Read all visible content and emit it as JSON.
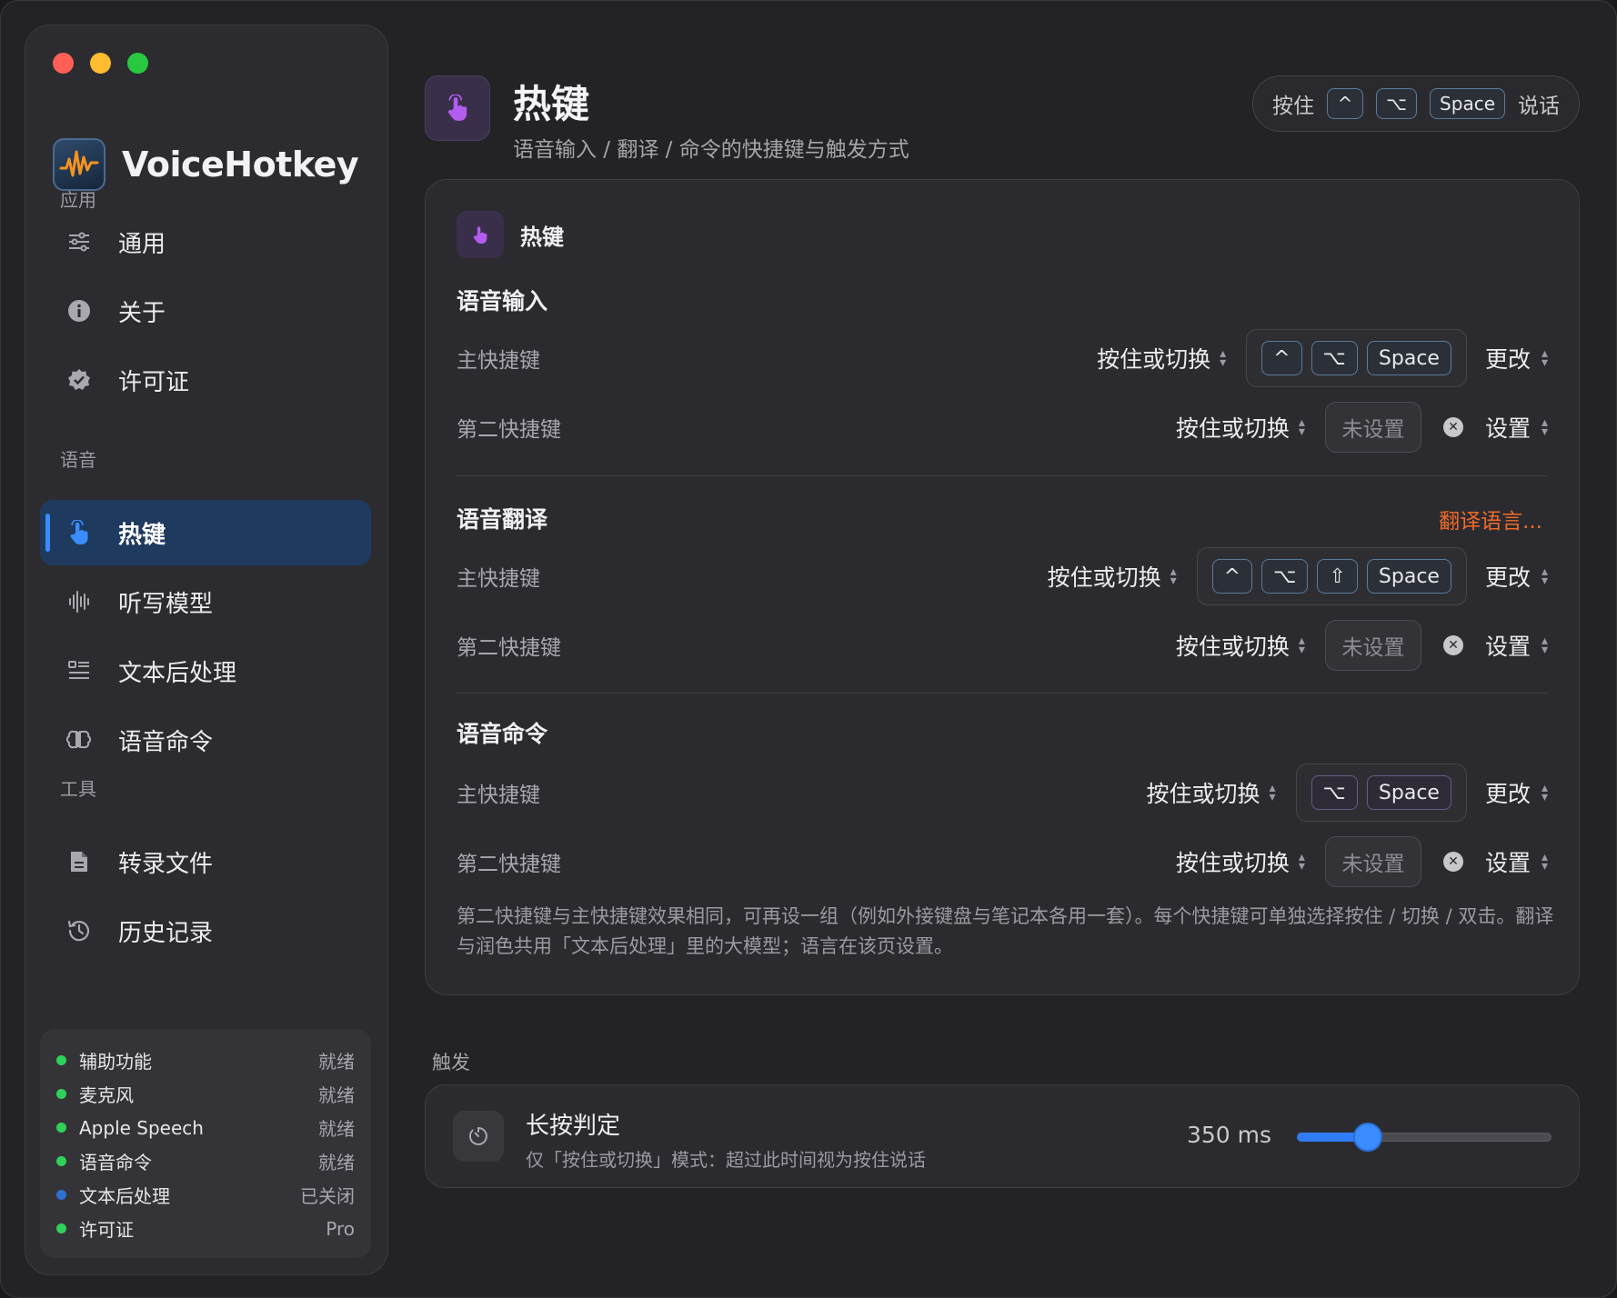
{
  "app": {
    "name": "VoiceHotkey"
  },
  "sidebar": {
    "sections": {
      "app": "应用",
      "voice": "语音",
      "tools": "工具"
    },
    "items": [
      {
        "label": "通用",
        "icon": "sliders-icon"
      },
      {
        "label": "关于",
        "icon": "info-icon"
      },
      {
        "label": "许可证",
        "icon": "badge-check-icon"
      },
      {
        "label": "热键",
        "icon": "hand-pointer-icon",
        "active": true
      },
      {
        "label": "听写模型",
        "icon": "waveform-icon"
      },
      {
        "label": "文本后处理",
        "icon": "text-list-icon"
      },
      {
        "label": "语音命令",
        "icon": "brain-icon"
      },
      {
        "label": "转录文件",
        "icon": "document-icon"
      },
      {
        "label": "历史记录",
        "icon": "history-icon"
      }
    ],
    "status": [
      {
        "name": "辅助功能",
        "value": "就绪",
        "color": "#30d158"
      },
      {
        "name": "麦克风",
        "value": "就绪",
        "color": "#30d158"
      },
      {
        "name": "Apple Speech",
        "value": "就绪",
        "color": "#30d158"
      },
      {
        "name": "语音命令",
        "value": "就绪",
        "color": "#30d158"
      },
      {
        "name": "文本后处理",
        "value": "已关闭",
        "color": "#2f6fd0"
      },
      {
        "name": "许可证",
        "value": "Pro",
        "color": "#30d158"
      }
    ]
  },
  "header": {
    "title": "热键",
    "subtitle": "语音输入 / 翻译 / 命令的快捷键与触发方式",
    "hint_prefix": "按住",
    "hint_keys": [
      "^",
      "⌥",
      "Space"
    ],
    "hint_suffix": "说话"
  },
  "card": {
    "title": "热键",
    "groups": [
      {
        "title": "语音输入",
        "link": "",
        "rows": [
          {
            "label": "主快捷键",
            "mode": "按住或切换",
            "keys": [
              "^",
              "⌥",
              "Space"
            ],
            "action": "更改"
          },
          {
            "label": "第二快捷键",
            "mode": "按住或切换",
            "unset": "未设置",
            "action": "设置"
          }
        ]
      },
      {
        "title": "语音翻译",
        "link": "翻译语言...",
        "rows": [
          {
            "label": "主快捷键",
            "mode": "按住或切换",
            "keys": [
              "^",
              "⌥",
              "⇧",
              "Space"
            ],
            "action": "更改"
          },
          {
            "label": "第二快捷键",
            "mode": "按住或切换",
            "unset": "未设置",
            "action": "设置"
          }
        ]
      },
      {
        "title": "语音命令",
        "link": "",
        "rows": [
          {
            "label": "主快捷键",
            "mode": "按住或切换",
            "keys": [
              "⌥",
              "Space"
            ],
            "action": "更改"
          },
          {
            "label": "第二快捷键",
            "mode": "按住或切换",
            "unset": "未设置",
            "action": "设置"
          }
        ]
      }
    ],
    "footnote": "第二快捷键与主快捷键效果相同，可再设一组（例如外接键盘与笔记本各用一套）。每个快捷键可单独选择按住 / 切换 / 双击。翻译与润色共用「文本后处理」里的大模型；语言在该页设置。"
  },
  "trigger": {
    "section": "触发",
    "title": "长按判定",
    "subtitle": "仅「按住或切换」模式：超过此时间视为按住说话",
    "value_text": "350 ms",
    "slider_fraction": 0.28
  },
  "colors": {
    "accent": "#3a8cff",
    "link": "#f06a2a",
    "hotkey_icon": "#b25cf0"
  }
}
